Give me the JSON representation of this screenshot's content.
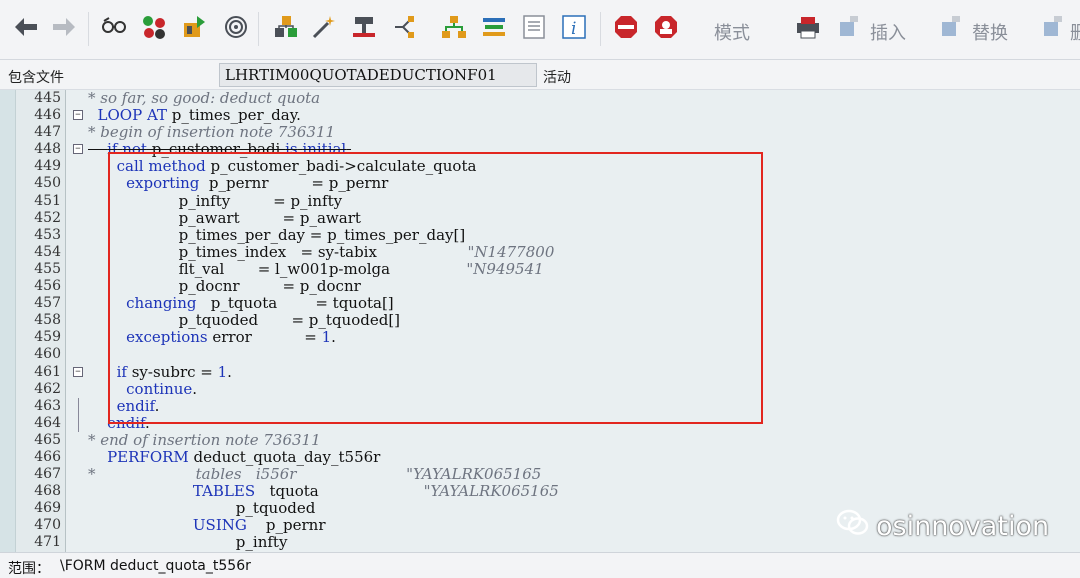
{
  "toolbar": {
    "mode_label": "模式",
    "insert_label": "插入",
    "replace_label": "替换",
    "cut_label": "删",
    "icons": [
      "back-icon",
      "forward-icon",
      "glasses-icon",
      "objects-icon",
      "activate-icon",
      "where-used-icon",
      "hierarchy-icon",
      "magic-wand-icon",
      "stamp-icon",
      "branch-icon",
      "tree-icon",
      "stack-icon",
      "document-icon",
      "info-icon",
      "stop-breakpoint-icon",
      "stop-user-icon",
      "pretty-printer-icon"
    ]
  },
  "header": {
    "include_label": "包含文件",
    "include_value": "LHRTIM00QUOTADEDUCTIONF01",
    "status_text": "活动"
  },
  "editor": {
    "lines": [
      {
        "no": "445",
        "text": "* so far, so good: deduct quota"
      },
      {
        "no": "446",
        "text": "  LOOP AT p_times_per_day."
      },
      {
        "no": "447",
        "text": "* begin of insertion note 736311"
      },
      {
        "no": "448",
        "text": "    if not p_customer_badi is initial."
      },
      {
        "no": "449",
        "text": "      call method p_customer_badi->calculate_quota"
      },
      {
        "no": "450",
        "text": "        exporting  p_pernr         = p_pernr"
      },
      {
        "no": "451",
        "text": "                   p_infty         = p_infty"
      },
      {
        "no": "452",
        "text": "                   p_awart         = p_awart"
      },
      {
        "no": "453",
        "text": "                   p_times_per_day = p_times_per_day[]"
      },
      {
        "no": "454",
        "text": "                   p_times_index   = sy-tabix                   \"N1477800"
      },
      {
        "no": "455",
        "text": "                   flt_val       = l_w001p-molga                \"N949541"
      },
      {
        "no": "456",
        "text": "                   p_docnr         = p_docnr"
      },
      {
        "no": "457",
        "text": "        changing   p_tquota        = tquota[]"
      },
      {
        "no": "458",
        "text": "                   p_tquoded       = p_tquoded[]"
      },
      {
        "no": "459",
        "text": "        exceptions error           = 1."
      },
      {
        "no": "460",
        "text": ""
      },
      {
        "no": "461",
        "text": "      if sy-subrc = 1."
      },
      {
        "no": "462",
        "text": "        continue."
      },
      {
        "no": "463",
        "text": "      endif."
      },
      {
        "no": "464",
        "text": "    endif."
      },
      {
        "no": "465",
        "text": "* end of insertion note 736311"
      },
      {
        "no": "466",
        "text": "    PERFORM deduct_quota_day_t556r"
      },
      {
        "no": "467",
        "text": "*                     tables   i556r                       \"YAYALRK065165"
      },
      {
        "no": "468",
        "text": "                      TABLES   tquota                      \"YAYALRK065165"
      },
      {
        "no": "469",
        "text": "                               p_tquoded"
      },
      {
        "no": "470",
        "text": "                      USING    p_pernr"
      },
      {
        "no": "471",
        "text": "                               p_infty"
      }
    ]
  },
  "watermark": {
    "text": "osinnovation"
  },
  "statusbar": {
    "scope_label": "范围：",
    "scope_value": "\\FORM deduct_quota_t556r"
  },
  "colors": {
    "highlight": "#e2261f",
    "keyword": "#1d34b8",
    "comment": "#6e7480"
  }
}
